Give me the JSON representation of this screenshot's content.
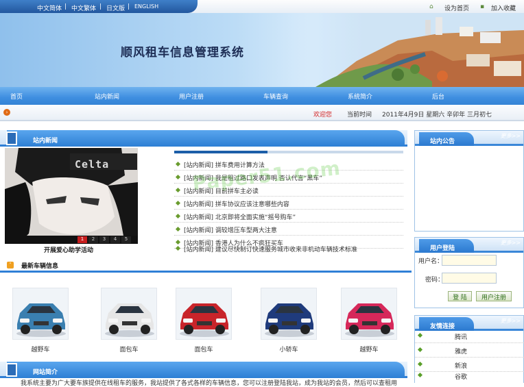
{
  "top": {
    "languages": [
      "中文简体",
      "中文繁体",
      "日文版",
      "ENGLISH"
    ],
    "set_home": "设为首页",
    "bookmark": "加入收藏"
  },
  "banner": {
    "title": "顺风租车信息管理系统"
  },
  "nav": [
    "首页",
    "站内新闻",
    "用户注册",
    "车辆查询",
    "系统简介",
    "后台"
  ],
  "datebar": {
    "welcome": "欢迎您",
    "time_label": "当前时间",
    "date": "2011年4月9日  星期六  辛卯年  三月初七"
  },
  "news": {
    "title": "站内新闻",
    "slide_caption": "开展爱心助学活动",
    "slide_pages": [
      "1",
      "2",
      "3",
      "4",
      "5"
    ],
    "items": [
      "[站内新闻]  拼车费用计算方法",
      "[站内新闻]  我是租过路口发表声明 否认代言“黑车”",
      "[站内新闻]  目前拼车主必读",
      "[站内新闻]  拼车协议应该注意哪些内容",
      "[站内新闻]  北京即将全面实施“摇号购车”",
      "[站内新闻]  调较增压车型两大注意",
      "[站内新闻]  香港人为什么不疯狂买车",
      "[站内新闻]  建议尽快制订快速服务城市收来非机动车辆技术标准"
    ]
  },
  "latest_cars": {
    "title": "最新车辆信息",
    "cars": [
      "越野车",
      "面包车",
      "面包车",
      "小轿车",
      "越野车"
    ],
    "colors": [
      "#3a7fb0",
      "#e6e6e6",
      "#c8242a",
      "#1f3b7c",
      "#d6285a"
    ]
  },
  "intro": {
    "title": "网站简介",
    "text": "我系统主要为广大要车族提供在线租车的服务，我站提供了各式各样的车辆信息，您可以注册登陆我站，成为我站的会员，然后可以查租用"
  },
  "notice": {
    "title": "站内公告",
    "more": "更多>>"
  },
  "login": {
    "title": "用户登陆",
    "more": "更多>>",
    "username_label": "用户名：",
    "password_label": "密码：",
    "login_btn": "登 陆",
    "register_btn": "用户注册"
  },
  "links": {
    "title": "友情连接",
    "more": "更多>>",
    "items": [
      "腾讯",
      "雅虎",
      "新浪",
      "谷歌"
    ]
  },
  "watermark": "Paper51.com"
}
